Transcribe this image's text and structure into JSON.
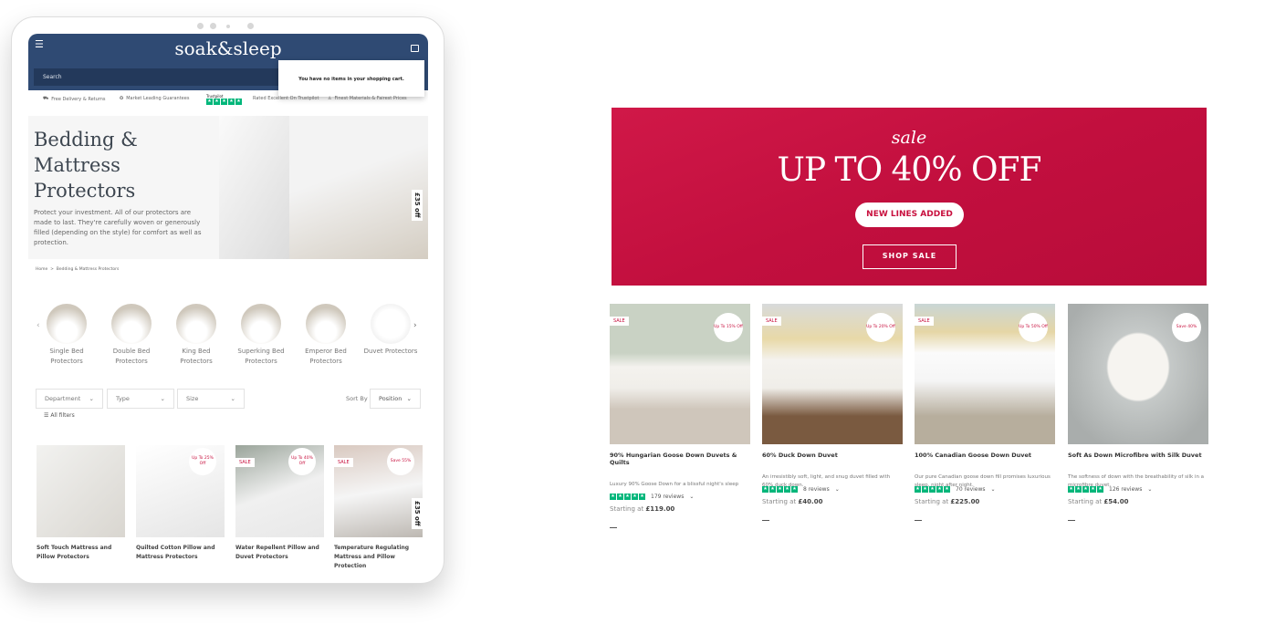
{
  "tablet": {
    "header": {
      "logo": "soak&sleep",
      "search_placeholder": "Search",
      "cart_message": "You have no items in your shopping cart.",
      "menu_icon": "hamburger-icon",
      "cart_icon": "shopping-bag-icon",
      "color": "#2f4a73"
    },
    "usps": [
      "Free Delivery & Returns",
      "Market Leading Guarantees",
      "Trustpilot",
      "Rated Excellent On Trustpilot",
      "Finest Materials & Fairest Prices"
    ],
    "hero": {
      "title": "Bedding & Mattress Protectors",
      "description": "Protect your investment. All of our protectors are made to last. They're carefully woven or generously filled (depending on the style) for comfort as well as protection.",
      "tag": "£35 off"
    },
    "breadcrumb": [
      "Home",
      "Bedding & Mattress Protectors"
    ],
    "categories": [
      "Single Bed Protectors",
      "Double Bed Protectors",
      "King Bed Protectors",
      "Superking Bed Protectors",
      "Emperor Bed Protectors",
      "Duvet Protectors"
    ],
    "filters": {
      "department": "Department",
      "type": "Type",
      "size": "Size",
      "sort_label": "Sort By",
      "sort_value": "Position",
      "all_filters": "All filters"
    },
    "products": [
      {
        "title": "Soft Touch Mattress and Pillow Protectors"
      },
      {
        "title": "Quilted Cotton Pillow and Mattress Protectors",
        "badge": "Up To 25% Off"
      },
      {
        "title": "Water Repellent Pillow and Duvet Protectors",
        "sale": "SALE",
        "badge": "Up To 40% Off"
      },
      {
        "title": "Temperature Regulating Mattress and Pillow Protection",
        "sale": "SALE",
        "badge": "Save 55%",
        "tag": "£35 off"
      }
    ]
  },
  "banner": {
    "script": "sale",
    "headline": "UP TO 40% OFF",
    "button1": "NEW LINES ADDED",
    "button2": "SHOP SALE",
    "color": "#c8103e"
  },
  "products": [
    {
      "title": "90% Hungarian Goose Down Duvets & Quilts",
      "sale": "SALE",
      "badge": "Up To 15% Off",
      "desc": "Luxury 90% Goose Down for a blissful night's sleep",
      "reviews": "179 reviews",
      "price_label": "Starting at",
      "price": "£119.00"
    },
    {
      "title": "60% Duck Down Duvet",
      "sale": "SALE",
      "badge": "Up To 20% Off",
      "desc": "An irresistibly soft, light, and snug duvet filled with 60% duck down.",
      "reviews": "8 reviews",
      "price_label": "Starting at",
      "price": "£40.00"
    },
    {
      "title": "100% Canadian Goose Down Duvet",
      "sale": "SALE",
      "badge": "Up To 50% Off",
      "desc": "Our pure Canadian goose down fill promises luxurious sleep, night after night.",
      "reviews": "70 reviews",
      "price_label": "Starting at",
      "price": "£225.00"
    },
    {
      "title": "Soft As Down Microfibre with Silk Duvet",
      "badge": "Save 40%",
      "desc": "The softness of down with the breathability of silk in a microfibre duvet.",
      "reviews": "126 reviews",
      "price_label": "Starting at",
      "price": "£54.00"
    }
  ],
  "rating_color": "#00b67a"
}
